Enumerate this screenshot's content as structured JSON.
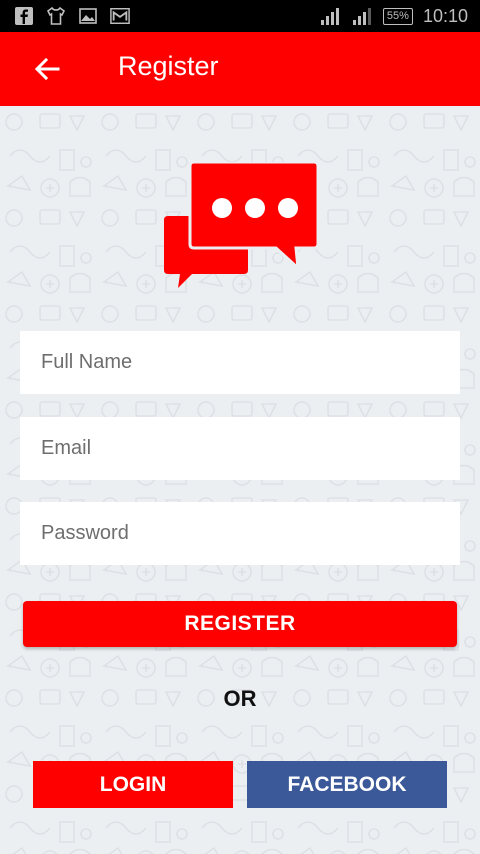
{
  "status_bar": {
    "battery": "55%",
    "time": "10:10",
    "left_icons": [
      "facebook-icon",
      "shirt-icon",
      "image-icon",
      "gmail-icon"
    ],
    "right_icons": [
      "signal-3g-icon",
      "signal-icon",
      "battery-icon"
    ]
  },
  "app_bar": {
    "title": "Register",
    "back_icon": "arrow-left-icon",
    "color": "#ff0000"
  },
  "logo": {
    "icon": "chat-bubbles-icon",
    "color": "#ff0000"
  },
  "form": {
    "full_name": {
      "placeholder": "Full Name",
      "value": ""
    },
    "email": {
      "placeholder": "Email",
      "value": ""
    },
    "password": {
      "placeholder": "Password",
      "value": ""
    }
  },
  "buttons": {
    "register": "REGISTER",
    "or": "OR",
    "login": "LOGIN",
    "facebook": "FACEBOOK"
  },
  "colors": {
    "accent": "#ff0000",
    "facebook": "#3b5998",
    "background": "#eceff2"
  }
}
